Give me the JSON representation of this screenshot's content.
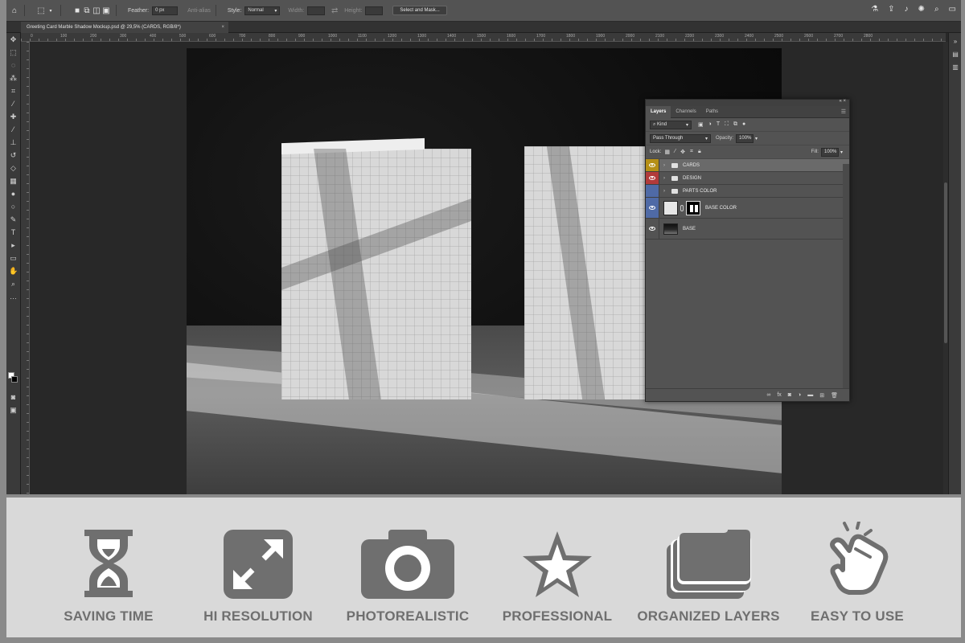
{
  "options_bar": {
    "feather_label": "Feather:",
    "feather_value": "0 px",
    "antialias_label": "Anti-alias",
    "style_label": "Style:",
    "style_value": "Normal",
    "width_label": "Width:",
    "height_label": "Height:",
    "select_mask_label": "Select and Mask..."
  },
  "document": {
    "tab_title": "Greeting Card Marble Shadow Mockup.psd @ 29,5% (CARDS, RGB/8*)",
    "tab_close": "×"
  },
  "ruler_ticks": [
    "0",
    "100",
    "200",
    "300",
    "400",
    "500",
    "600",
    "700",
    "800",
    "900",
    "1000",
    "1100",
    "1200",
    "1300",
    "1400",
    "1500",
    "1600",
    "1700",
    "1800",
    "1900",
    "2000",
    "2100",
    "2200",
    "2300",
    "2400",
    "2500",
    "2600",
    "2700",
    "2800"
  ],
  "layers_panel": {
    "tabs": [
      "Layers",
      "Channels",
      "Paths"
    ],
    "kind_label": "Kind",
    "blend_mode": "Pass Through",
    "opacity_label": "Opacity:",
    "opacity_value": "100%",
    "lock_label": "Lock:",
    "fill_label": "Fill:",
    "fill_value": "100%",
    "layers": [
      {
        "name": "CARDS",
        "color": "#b58f16",
        "visible": true,
        "type": "group"
      },
      {
        "name": "DESIGN",
        "color": "#b23a3a",
        "visible": true,
        "type": "group"
      },
      {
        "name": "PARTS COLOR",
        "color": "#4f6aa6",
        "visible": false,
        "type": "group"
      },
      {
        "name": "BASE COLOR",
        "color": "#4f6aa6",
        "visible": true,
        "type": "masked"
      },
      {
        "name": "BASE",
        "color": "",
        "visible": true,
        "type": "image"
      }
    ]
  },
  "features": [
    {
      "label": "SAVING TIME",
      "icon": "hourglass-icon"
    },
    {
      "label": "HI RESOLUTION",
      "icon": "expand-icon"
    },
    {
      "label": "PHOTOREALISTIC",
      "icon": "camera-icon"
    },
    {
      "label": "PROFESSIONAL",
      "icon": "star-icon"
    },
    {
      "label": "ORGANIZED LAYERS",
      "icon": "layers-icon"
    },
    {
      "label": "EASY TO USE",
      "icon": "hand-tap-icon"
    }
  ],
  "colors": {
    "workspace": "#282828",
    "panel": "#535353",
    "feature_icon": "#6f6f6f",
    "feature_background": "#d9d9d9"
  }
}
